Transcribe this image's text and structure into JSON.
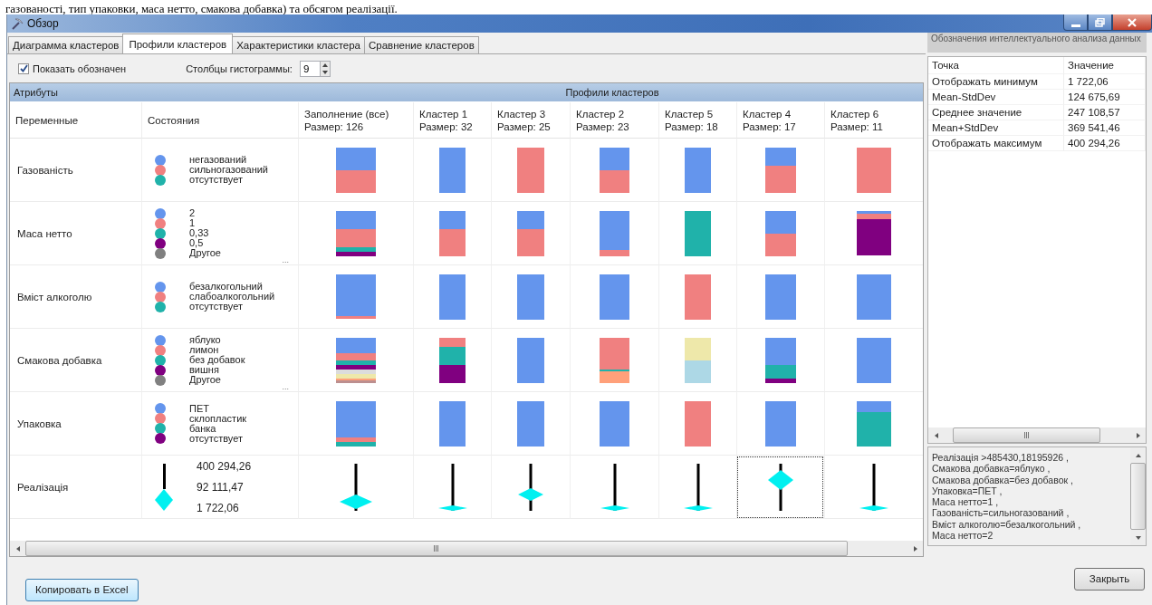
{
  "document_text": "газованості, тип упаковки, маса нетто, смакова добавка) та обсягом реалізації.",
  "window": {
    "title": "Обзор"
  },
  "tabs": [
    {
      "label": "Диаграмма кластеров",
      "selected": false
    },
    {
      "label": "Профили кластеров",
      "selected": true
    },
    {
      "label": "Характеристики кластера",
      "selected": false
    },
    {
      "label": "Сравнение кластеров",
      "selected": false
    }
  ],
  "toolbar": {
    "show_legend": {
      "label": "Показать обозначен",
      "checked": true
    },
    "histogram": {
      "label": "Столбцы гистограммы:",
      "value": "9"
    }
  },
  "grid": {
    "bands": [
      "Атрибуты",
      "Профили кластеров"
    ],
    "columns": [
      {
        "title": "Переменные"
      },
      {
        "title": "Состояния"
      },
      {
        "title": "Заполнение (все)",
        "size": "Размер: 126"
      },
      {
        "title": "Кластер 1",
        "size": "Размер: 32"
      },
      {
        "title": "Кластер 3",
        "size": "Размер: 25"
      },
      {
        "title": "Кластер 2",
        "size": "Размер: 23"
      },
      {
        "title": "Кластер 5",
        "size": "Размер: 18"
      },
      {
        "title": "Кластер 4",
        "size": "Размер: 17"
      },
      {
        "title": "Кластер 6",
        "size": "Размер: 11"
      }
    ],
    "rows": [
      {
        "kind": "distribution",
        "name": "Газованість",
        "states": [
          {
            "label": "негазований",
            "color": "#6495ed"
          },
          {
            "label": "сильногазований",
            "color": "#f08080"
          },
          {
            "label": "отсутствует",
            "color": "#20b2aa"
          }
        ],
        "profiles": [
          {
            "selected": false,
            "bar": [
              {
                "color": "#6495ed"
              },
              {
                "color": "#f08080"
              }
            ]
          },
          {
            "selected": false,
            "bar": [
              {
                "color": "#6495ed"
              }
            ]
          },
          {
            "selected": false,
            "bar": [
              {
                "color": "#f08080"
              }
            ]
          },
          {
            "selected": false,
            "bar": [
              {
                "color": "#6495ed"
              },
              {
                "color": "#f08080"
              }
            ]
          },
          {
            "selected": false,
            "bar": [
              {
                "color": "#6495ed"
              }
            ]
          },
          {
            "selected": false,
            "bar": [
              {
                "color": "#6495ed"
              },
              {
                "color": "#6495ed"
              },
              {
                "color": "#f08080"
              },
              {
                "color": "#f08080"
              },
              {
                "color": "#f08080"
              }
            ]
          },
          {
            "selected": false,
            "bar": [
              {
                "color": "#f08080"
              }
            ]
          }
        ]
      },
      {
        "kind": "distribution",
        "name": "Маса нетто",
        "more": "...",
        "states": [
          {
            "label": "2",
            "color": "#6495ed"
          },
          {
            "label": "1",
            "color": "#f08080"
          },
          {
            "label": "0,33",
            "color": "#20b2aa"
          },
          {
            "label": "0,5",
            "color": "#800080"
          },
          {
            "label": "Другое",
            "color": "#808080"
          }
        ],
        "profiles": [
          {
            "selected": false,
            "bar": [
              {
                "color": "#6495ed"
              },
              {
                "color": "#6495ed"
              },
              {
                "color": "#6495ed"
              },
              {
                "color": "#6495ed"
              },
              {
                "color": "#f08080"
              },
              {
                "color": "#f08080"
              },
              {
                "color": "#f08080"
              },
              {
                "color": "#f08080"
              },
              {
                "color": "#20b2aa"
              },
              {
                "color": "#800080"
              }
            ]
          },
          {
            "selected": false,
            "bar": [
              {
                "color": "#6495ed"
              },
              {
                "color": "#6495ed"
              },
              {
                "color": "#f08080"
              },
              {
                "color": "#f08080"
              },
              {
                "color": "#f08080"
              }
            ]
          },
          {
            "selected": false,
            "bar": [
              {
                "color": "#6495ed"
              },
              {
                "color": "#6495ed"
              },
              {
                "color": "#f08080"
              },
              {
                "color": "#f08080"
              },
              {
                "color": "#f08080"
              }
            ]
          },
          {
            "selected": false,
            "bar": [
              {
                "color": "#6495ed"
              },
              {
                "color": "#6495ed"
              },
              {
                "color": "#6495ed"
              },
              {
                "color": "#6495ed"
              },
              {
                "color": "#6495ed"
              },
              {
                "color": "#6495ed"
              },
              {
                "color": "#6495ed"
              },
              {
                "color": "#f08080"
              }
            ]
          },
          {
            "selected": false,
            "bar": [
              {
                "color": "#20b2aa"
              }
            ]
          },
          {
            "selected": false,
            "bar": [
              {
                "color": "#6495ed"
              },
              {
                "color": "#f08080"
              }
            ]
          },
          {
            "selected": false,
            "bar": [
              {
                "color": "#6495ed"
              },
              {
                "color": "#f08080"
              },
              {
                "color": "#f08080"
              },
              {
                "color": "#800080"
              },
              {
                "color": "#800080"
              },
              {
                "color": "#800080"
              },
              {
                "color": "#800080"
              },
              {
                "color": "#800080"
              },
              {
                "color": "#800080"
              },
              {
                "color": "#800080"
              },
              {
                "color": "#800080"
              },
              {
                "color": "#800080"
              },
              {
                "color": "#800080"
              },
              {
                "color": "#800080"
              },
              {
                "color": "#800080"
              }
            ]
          }
        ]
      },
      {
        "kind": "distribution",
        "name": "Вміст алкоголю",
        "states": [
          {
            "label": "безалкогольний",
            "color": "#6495ed"
          },
          {
            "label": "слабоалкогольний",
            "color": "#f08080"
          },
          {
            "label": "отсутствует",
            "color": "#20b2aa"
          }
        ],
        "profiles": [
          {
            "selected": false,
            "bar": [
              {
                "color": "#6495ed"
              },
              {
                "color": "#6495ed"
              },
              {
                "color": "#6495ed"
              },
              {
                "color": "#6495ed"
              },
              {
                "color": "#6495ed"
              },
              {
                "color": "#6495ed"
              },
              {
                "color": "#6495ed"
              },
              {
                "color": "#6495ed"
              },
              {
                "color": "#6495ed"
              },
              {
                "color": "#6495ed"
              },
              {
                "color": "#6495ed"
              },
              {
                "color": "#6495ed"
              },
              {
                "color": "#6495ed"
              },
              {
                "color": "#f08080"
              }
            ]
          },
          {
            "selected": false,
            "bar": [
              {
                "color": "#6495ed"
              }
            ]
          },
          {
            "selected": false,
            "bar": [
              {
                "color": "#6495ed"
              }
            ]
          },
          {
            "selected": false,
            "bar": [
              {
                "color": "#6495ed"
              }
            ]
          },
          {
            "selected": false,
            "bar": [
              {
                "color": "#f08080"
              }
            ]
          },
          {
            "selected": false,
            "bar": [
              {
                "color": "#6495ed"
              }
            ]
          },
          {
            "selected": false,
            "bar": [
              {
                "color": "#6495ed"
              }
            ]
          }
        ]
      },
      {
        "kind": "distribution",
        "name": "Смакова добавка",
        "more": "...",
        "states": [
          {
            "label": "яблуко",
            "color": "#6495ed"
          },
          {
            "label": "лимон",
            "color": "#f08080"
          },
          {
            "label": "без добавок",
            "color": "#20b2aa"
          },
          {
            "label": "вишня",
            "color": "#800080"
          },
          {
            "label": "Другое",
            "color": "#808080"
          }
        ],
        "profiles": [
          {
            "selected": false,
            "bar": [
              {
                "color": "#6495ed"
              },
              {
                "color": "#6495ed"
              },
              {
                "color": "#6495ed"
              },
              {
                "color": "#6495ed"
              },
              {
                "color": "#6495ed"
              },
              {
                "color": "#6495ed"
              },
              {
                "color": "#6495ed"
              },
              {
                "color": "#f08080"
              },
              {
                "color": "#f08080"
              },
              {
                "color": "#f08080"
              },
              {
                "color": "#20b2aa"
              },
              {
                "color": "#20b2aa"
              },
              {
                "color": "#800080"
              },
              {
                "color": "#800080"
              },
              {
                "color": "#dcdcdc"
              },
              {
                "color": "#dcdcdc"
              },
              {
                "color": "#eee8aa"
              },
              {
                "color": "#eee8aa"
              },
              {
                "color": "#ffa07a"
              },
              {
                "color": "#bc8f8f"
              }
            ]
          },
          {
            "selected": false,
            "bar": [
              {
                "color": "#f08080"
              },
              {
                "color": "#f08080"
              },
              {
                "color": "#20b2aa"
              },
              {
                "color": "#20b2aa"
              },
              {
                "color": "#20b2aa"
              },
              {
                "color": "#20b2aa"
              },
              {
                "color": "#800080"
              },
              {
                "color": "#800080"
              },
              {
                "color": "#800080"
              },
              {
                "color": "#800080"
              }
            ]
          },
          {
            "selected": false,
            "bar": [
              {
                "color": "#6495ed"
              }
            ]
          },
          {
            "selected": false,
            "bar": [
              {
                "color": "#f08080"
              },
              {
                "color": "#f08080"
              },
              {
                "color": "#f08080"
              },
              {
                "color": "#f08080"
              },
              {
                "color": "#f08080"
              },
              {
                "color": "#f08080"
              },
              {
                "color": "#f08080"
              },
              {
                "color": "#f08080"
              },
              {
                "color": "#f08080"
              },
              {
                "color": "#f08080"
              },
              {
                "color": "#f08080"
              },
              {
                "color": "#f08080"
              },
              {
                "color": "#f08080"
              },
              {
                "color": "#f08080"
              },
              {
                "color": "#20b2aa"
              },
              {
                "color": "#ffa07a"
              },
              {
                "color": "#ffa07a"
              },
              {
                "color": "#ffa07a"
              },
              {
                "color": "#ffa07a"
              },
              {
                "color": "#ffa07a"
              }
            ]
          },
          {
            "selected": false,
            "bar": [
              {
                "color": "#eee8aa"
              },
              {
                "color": "#add8e6"
              }
            ]
          },
          {
            "selected": false,
            "bar": [
              {
                "color": "#6495ed"
              },
              {
                "color": "#6495ed"
              },
              {
                "color": "#6495ed"
              },
              {
                "color": "#6495ed"
              },
              {
                "color": "#6495ed"
              },
              {
                "color": "#6495ed"
              },
              {
                "color": "#20b2aa"
              },
              {
                "color": "#20b2aa"
              },
              {
                "color": "#20b2aa"
              },
              {
                "color": "#800080"
              }
            ]
          },
          {
            "selected": false,
            "bar": [
              {
                "color": "#6495ed"
              }
            ]
          }
        ]
      },
      {
        "kind": "distribution",
        "name": "Упаковка",
        "states": [
          {
            "label": "ПЕТ",
            "color": "#6495ed"
          },
          {
            "label": "склопластик",
            "color": "#f08080"
          },
          {
            "label": "банка",
            "color": "#20b2aa"
          },
          {
            "label": "отсутствует",
            "color": "#800080"
          }
        ],
        "profiles": [
          {
            "selected": false,
            "bar": [
              {
                "color": "#6495ed"
              },
              {
                "color": "#6495ed"
              },
              {
                "color": "#6495ed"
              },
              {
                "color": "#6495ed"
              },
              {
                "color": "#6495ed"
              },
              {
                "color": "#6495ed"
              },
              {
                "color": "#6495ed"
              },
              {
                "color": "#6495ed"
              },
              {
                "color": "#6495ed"
              },
              {
                "color": "#6495ed"
              },
              {
                "color": "#6495ed"
              },
              {
                "color": "#6495ed"
              },
              {
                "color": "#6495ed"
              },
              {
                "color": "#6495ed"
              },
              {
                "color": "#6495ed"
              },
              {
                "color": "#6495ed"
              },
              {
                "color": "#f08080"
              },
              {
                "color": "#f08080"
              },
              {
                "color": "#20b2aa"
              },
              {
                "color": "#20b2aa"
              }
            ]
          },
          {
            "selected": false,
            "bar": [
              {
                "color": "#6495ed"
              }
            ]
          },
          {
            "selected": false,
            "bar": [
              {
                "color": "#6495ed"
              }
            ]
          },
          {
            "selected": false,
            "bar": [
              {
                "color": "#6495ed"
              }
            ]
          },
          {
            "selected": false,
            "bar": [
              {
                "color": "#f08080"
              }
            ]
          },
          {
            "selected": false,
            "bar": [
              {
                "color": "#6495ed"
              }
            ]
          },
          {
            "selected": false,
            "bar": [
              {
                "color": "#6495ed"
              },
              {
                "color": "#20b2aa"
              },
              {
                "color": "#20b2aa"
              },
              {
                "color": "#20b2aa"
              }
            ]
          }
        ]
      },
      {
        "kind": "range",
        "name": "Реалізація",
        "values": [
          "400 294,26",
          "92 111,47",
          "1 722,06"
        ],
        "profiles": [
          {
            "selected": false,
            "kind": "lower"
          },
          {
            "selected": false,
            "kind": "bottom"
          },
          {
            "selected": false,
            "kind": "middle"
          },
          {
            "selected": false,
            "kind": "bottom"
          },
          {
            "selected": false,
            "kind": "bottom"
          },
          {
            "selected": true,
            "kind": "upper"
          },
          {
            "selected": false,
            "kind": "bottom"
          }
        ]
      }
    ]
  },
  "legend": {
    "title": "Обозначения интеллектуального анализа данных",
    "columns": [
      "Точка",
      "Значение"
    ],
    "rows": [
      [
        "Отображать минимум",
        "1 722,06"
      ],
      [
        "Mean-StdDev",
        "124 675,69"
      ],
      [
        "Среднее значение",
        "247 108,57"
      ],
      [
        "Mean+StdDev",
        "369 541,46"
      ],
      [
        "Отображать максимум",
        "400 294,26"
      ]
    ]
  },
  "details": [
    "Реалізація >485430,18195926 ,",
    "Смакова добавка=яблуко ,",
    "Смакова добавка=без добавок ,",
    "Упаковка=ПЕТ ,",
    "Маса нетто=1 ,",
    "Газованість=сильногазований ,",
    "Вміст алкоголю=безалкогольний ,",
    "Маса нетто=2"
  ],
  "buttons": {
    "copy": "Копировать в Excel",
    "close": "Закрыть"
  }
}
